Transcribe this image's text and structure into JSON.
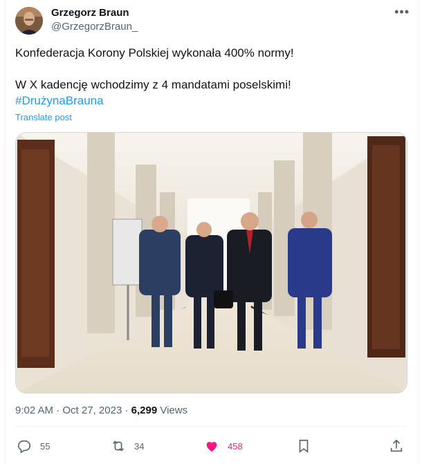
{
  "author": {
    "name": "Grzegorz Braun",
    "handle": "@GrzegorzBraun_"
  },
  "tweet": {
    "line1": "Konfederacja Korony Polskiej  wykonała 400% normy!",
    "line2": "W X kadencję wchodzimy z 4 mandatami poselskimi!",
    "hashtag": "#DrużynaBrauna",
    "translate_label": "Translate post"
  },
  "meta": {
    "time": "9:02 AM",
    "separator": "·",
    "date": "Oct 27, 2023",
    "views_count": "6,299",
    "views_label": "Views"
  },
  "actions": {
    "replies": "55",
    "reposts": "34",
    "likes": "458"
  },
  "colors": {
    "accent": "#1d9bf0",
    "like": "#f91880",
    "muted": "#536471"
  }
}
